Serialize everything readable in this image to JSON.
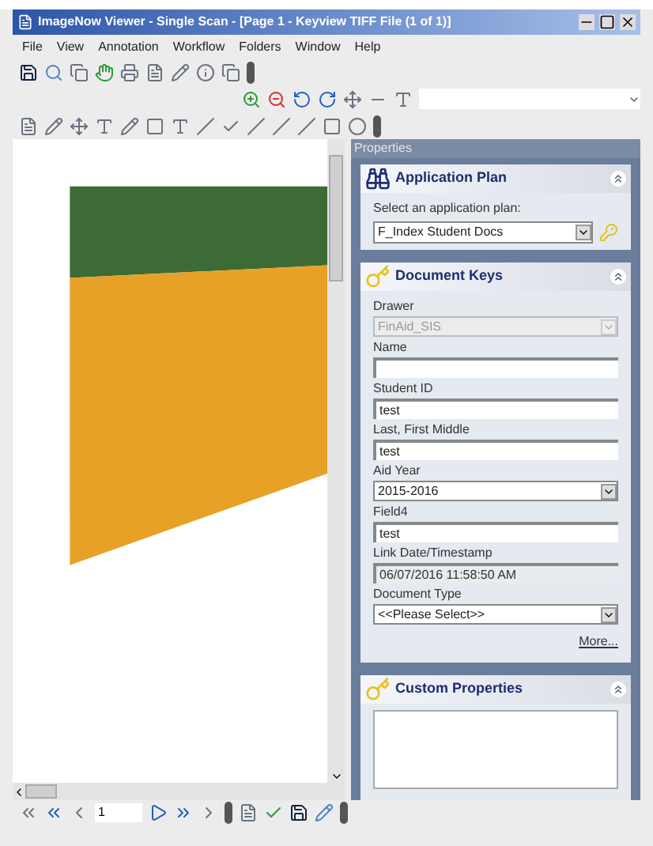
{
  "window": {
    "title": "ImageNow Viewer - Single Scan - [Page 1 - Keyview TIFF File (1 of 1)]"
  },
  "menu": [
    "File",
    "View",
    "Annotation",
    "Workflow",
    "Folders",
    "Window",
    "Help"
  ],
  "document": {
    "kind": "picture"
  },
  "navigation": {
    "page": "1"
  },
  "properties": {
    "title": "Properties",
    "application_plan": {
      "title": "Application Plan",
      "label": "Select an application plan:",
      "value": "F_Index Student Docs"
    },
    "document_keys": {
      "title": "Document Keys",
      "fields": [
        {
          "label": "Drawer",
          "kind": "select",
          "value": "FinAid_SIS",
          "disabled": true
        },
        {
          "label": "Name",
          "kind": "text"
        },
        {
          "label": "Student ID",
          "kind": "text",
          "value": "test"
        },
        {
          "label": "Last, First Middle",
          "kind": "text",
          "value": "test"
        },
        {
          "label": "Aid Year",
          "kind": "select",
          "value": "2015-2016"
        },
        {
          "label": "Field4",
          "kind": "text",
          "value": "test"
        },
        {
          "label": "Link Date/Timestamp",
          "kind": "readonly",
          "value": "06/07/2016 11:58:50 AM"
        },
        {
          "label": "Document Type",
          "kind": "select",
          "value": "<<Please Select>>"
        }
      ],
      "more_link": "More..."
    },
    "custom_properties": {
      "title": "Custom Properties"
    }
  }
}
